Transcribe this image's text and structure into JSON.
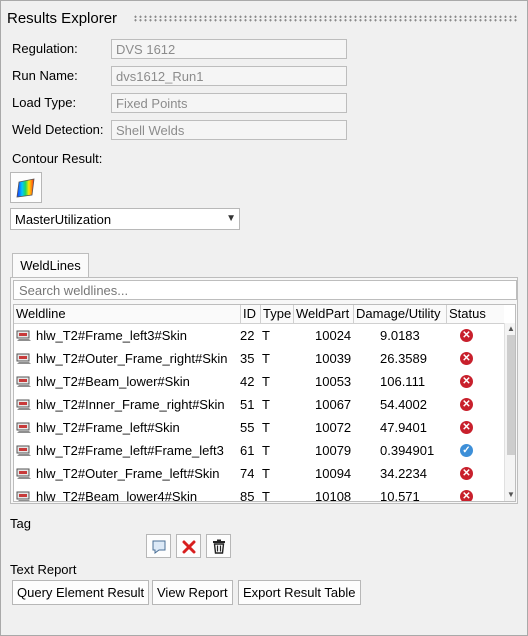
{
  "panel": {
    "title": "Results Explorer"
  },
  "form": {
    "regulation": {
      "label": "Regulation:",
      "value": "DVS 1612"
    },
    "run_name": {
      "label": "Run Name:",
      "value": "dvs1612_Run1"
    },
    "load_type": {
      "label": "Load Type:",
      "value": "Fixed Points"
    },
    "weld_detection": {
      "label": "Weld Detection:",
      "value": "Shell Welds"
    }
  },
  "contour": {
    "label": "Contour Result:",
    "selected": "MasterUtilization",
    "icon": "color-map-icon"
  },
  "tabs": [
    {
      "label": "WeldLines"
    }
  ],
  "search": {
    "placeholder": "Search weldlines..."
  },
  "table": {
    "columns": [
      "Weldline",
      "ID",
      "Type",
      "WeldPart",
      "Damage/Utility",
      "Status"
    ],
    "rows": [
      {
        "weldline": "hlw_T2#Frame_left3#Skin",
        "id": "22",
        "type": "T",
        "weldpart": "10024",
        "damage": "9.0183",
        "status": "fail"
      },
      {
        "weldline": "hlw_T2#Outer_Frame_right#Skin",
        "id": "35",
        "type": "T",
        "weldpart": "10039",
        "damage": "26.3589",
        "status": "fail"
      },
      {
        "weldline": "hlw_T2#Beam_lower#Skin",
        "id": "42",
        "type": "T",
        "weldpart": "10053",
        "damage": "106.111",
        "status": "fail"
      },
      {
        "weldline": "hlw_T2#Inner_Frame_right#Skin",
        "id": "51",
        "type": "T",
        "weldpart": "10067",
        "damage": "54.4002",
        "status": "fail"
      },
      {
        "weldline": "hlw_T2#Frame_left#Skin",
        "id": "55",
        "type": "T",
        "weldpart": "10072",
        "damage": "47.9401",
        "status": "fail"
      },
      {
        "weldline": "hlw_T2#Frame_left#Frame_left3",
        "id": "61",
        "type": "T",
        "weldpart": "10079",
        "damage": "0.394901",
        "status": "ok"
      },
      {
        "weldline": "hlw_T2#Outer_Frame_left#Skin",
        "id": "74",
        "type": "T",
        "weldpart": "10094",
        "damage": "34.2234",
        "status": "fail"
      },
      {
        "weldline": "hlw_T2#Beam_lower4#Skin",
        "id": "85",
        "type": "T",
        "weldpart": "10108",
        "damage": "10.571",
        "status": "fail"
      }
    ]
  },
  "tag": {
    "label": "Tag"
  },
  "text_report": {
    "label": "Text Report",
    "buttons": [
      "Query Element Result",
      "View Report",
      "Export Result Table"
    ]
  },
  "colors": {
    "fail": "#c8202c",
    "ok": "#3d8fd8"
  }
}
